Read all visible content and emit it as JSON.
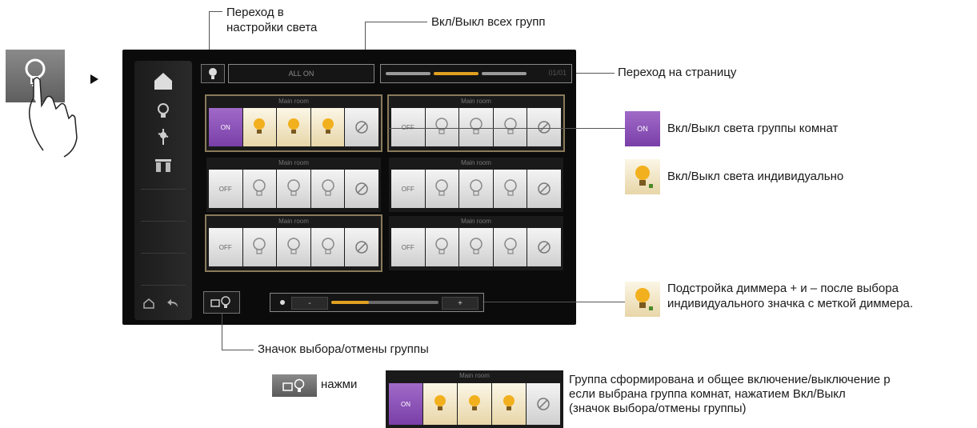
{
  "callouts": {
    "light_settings": [
      "Переход в",
      "настройки света"
    ],
    "all_groups": "Вкл/Выкл всех групп",
    "page_nav": "Переход на страницу",
    "group_select": "Значок выбора/отмены группы"
  },
  "screen": {
    "all_on_label": "ALL ON",
    "page_number": "01/01",
    "groups": [
      {
        "title": "Main room",
        "state": "ON",
        "lamps": [
          "lit",
          "lit",
          "lit"
        ],
        "selected": true
      },
      {
        "title": "Main room",
        "state": "OFF",
        "lamps": [
          "off",
          "off",
          "off"
        ],
        "selected": true
      },
      {
        "title": "Main room",
        "state": "OFF",
        "lamps": [
          "off",
          "off",
          "off"
        ],
        "selected": false
      },
      {
        "title": "Main room",
        "state": "OFF",
        "lamps": [
          "off",
          "off",
          "off"
        ],
        "selected": false
      },
      {
        "title": "Main room",
        "state": "OFF",
        "lamps": [
          "off",
          "off",
          "off"
        ],
        "selected": true
      },
      {
        "title": "Main room",
        "state": "OFF",
        "lamps": [
          "off",
          "off",
          "off"
        ],
        "selected": false
      }
    ],
    "dimmer": {
      "minus": "-",
      "plus": "+",
      "level": 0.35
    }
  },
  "legend": {
    "on_icon_text": "ON",
    "group_onoff": "Вкл/Выкл света группы комнат",
    "individual_onoff": "Вкл/Выкл света индивидуально",
    "dimmer_adjust": [
      "Подстройка диммера + и – после выбора",
      "индивидуального значка с меткой диммера."
    ]
  },
  "footer": {
    "press_label": "нажми",
    "example_title": "Main room",
    "example_state": "ON",
    "description": [
      "Группа сформирована и общее включение/выключение р",
      "если выбрана группа комнат, нажатием Вкл/Выкл",
      "(значок выбора/отмены группы)"
    ]
  },
  "colors": {
    "accent_on": "#8a4fb8",
    "lamp_lit": "#f2b01e",
    "dimmer_fill": "#e0a020"
  }
}
